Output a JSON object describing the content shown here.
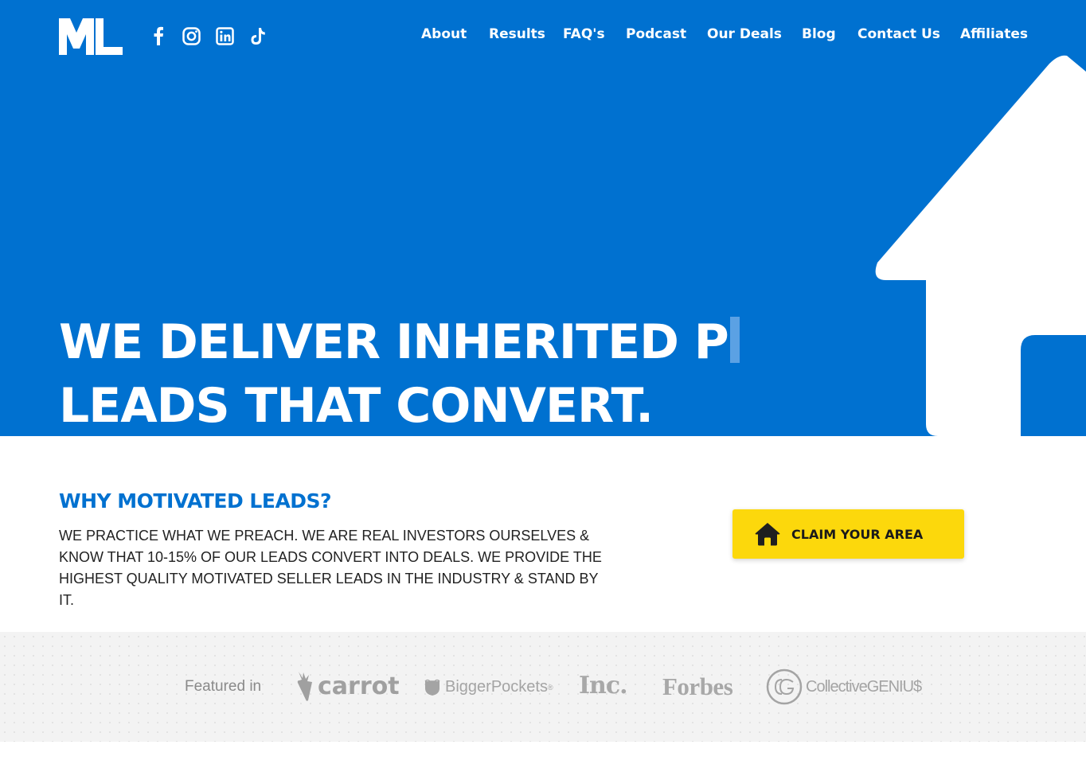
{
  "brand": {
    "logo_text": "ML"
  },
  "social": [
    {
      "name": "facebook-icon"
    },
    {
      "name": "instagram-icon"
    },
    {
      "name": "linkedin-icon"
    },
    {
      "name": "tiktok-icon"
    }
  ],
  "nav": {
    "items": [
      "About",
      "Results",
      "FAQ's",
      "Podcast",
      "Our Deals",
      "Blog",
      "Contact Us",
      "Affiliates"
    ]
  },
  "hero": {
    "headline_line1": "WE DELIVER INHERITED P",
    "headline_line2": "LEADS THAT CONVERT."
  },
  "why": {
    "title": "WHY MOTIVATED LEADS?",
    "body": "WE PRACTICE WHAT WE PREACH. WE ARE REAL INVESTORS OURSELVES & KNOW THAT 10-15% OF OUR LEADS CONVERT INTO DEALS. WE PROVIDE THE HIGHEST QUALITY MOTIVATED SELLER LEADS IN THE INDUSTRY & STAND BY IT."
  },
  "cta": {
    "label": "CLAIM YOUR AREA"
  },
  "featured": {
    "label": "Featured in",
    "logos": {
      "carrot": "carrot",
      "biggerpockets": "BiggerPockets",
      "inc": "Inc.",
      "forbes": "Forbes",
      "collective_genius": "CollectiveGENIU$"
    }
  },
  "colors": {
    "primary_blue": "#0071d0",
    "cta_yellow": "#fcd80c",
    "featured_bg": "#f3f3f3"
  }
}
